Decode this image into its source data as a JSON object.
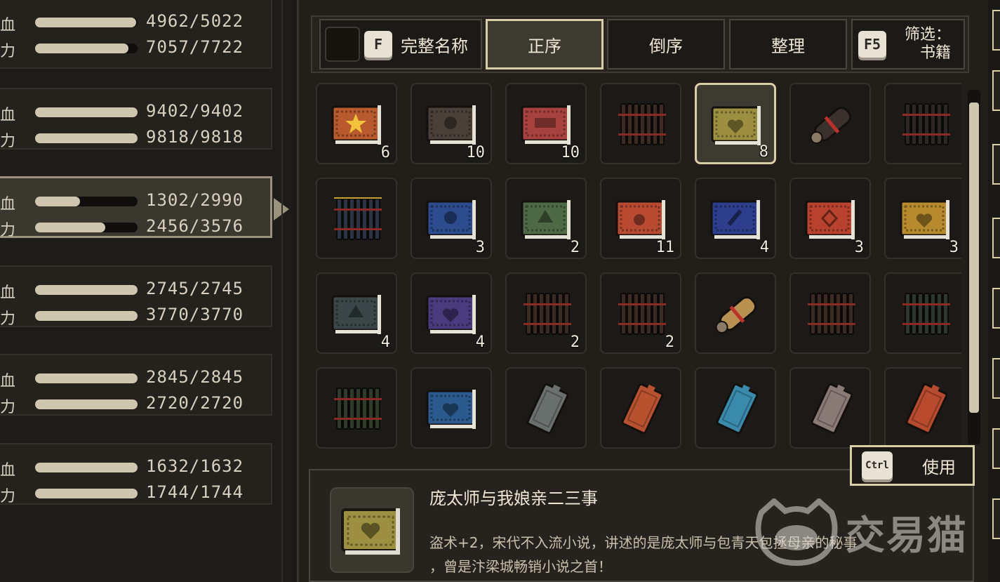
{
  "party": {
    "members": [
      {
        "hp_label": "气血",
        "mp_label": "内力",
        "hp": "4962/5022",
        "mp": "7057/7722",
        "hp_frac": 0.988,
        "mp_frac": 0.914,
        "active": false
      },
      {
        "hp_label": "气血",
        "mp_label": "内力",
        "hp": "9402/9402",
        "mp": "9818/9818",
        "hp_frac": 1.0,
        "mp_frac": 1.0,
        "active": false
      },
      {
        "hp_label": "气血",
        "mp_label": "内力",
        "hp": "1302/2990",
        "mp": "2456/3576",
        "hp_frac": 0.435,
        "mp_frac": 0.687,
        "active": true
      },
      {
        "hp_label": "气血",
        "mp_label": "内力",
        "hp": "2745/2745",
        "mp": "3770/3770",
        "hp_frac": 1.0,
        "mp_frac": 1.0,
        "active": false
      },
      {
        "hp_label": "气血",
        "mp_label": "内力",
        "hp": "2845/2845",
        "mp": "2720/2720",
        "hp_frac": 1.0,
        "mp_frac": 1.0,
        "active": false
      },
      {
        "hp_label": "气血",
        "mp_label": "内力",
        "hp": "1632/1632",
        "mp": "1744/1744",
        "hp_frac": 1.0,
        "mp_frac": 1.0,
        "active": false
      }
    ]
  },
  "toolbar": {
    "fullname_key": "F",
    "fullname_label": "完整名称",
    "sort_asc_label": "正序",
    "sort_desc_label": "倒序",
    "organize_label": "整理",
    "filter_key": "F5",
    "filter_label": "筛选：",
    "filter_value": "书籍"
  },
  "items": [
    {
      "icon": "scroll-star-book",
      "color": "#b85a2e",
      "count": "6"
    },
    {
      "icon": "skull-book",
      "color": "#4a4038",
      "count": "10"
    },
    {
      "icon": "pattern-book",
      "color": "#a8423e",
      "count": "10"
    },
    {
      "icon": "bamboo-scroll",
      "color": "#3a2a22",
      "count": ""
    },
    {
      "icon": "heart-book",
      "color": "#9c9040",
      "count": "8",
      "selected": true
    },
    {
      "icon": "rolled-scroll",
      "color": "#3a302c",
      "count": ""
    },
    {
      "icon": "bamboo-slips",
      "color": "#2e2622",
      "count": ""
    },
    {
      "icon": "bamboo-slips-blue",
      "color": "#2a3444",
      "count": ""
    },
    {
      "icon": "skull-book",
      "color": "#2c4c8e",
      "count": "3"
    },
    {
      "icon": "tree-book",
      "color": "#4e6a44",
      "count": "2"
    },
    {
      "icon": "fist-book",
      "color": "#b84a32",
      "count": "11"
    },
    {
      "icon": "sword-book",
      "color": "#2c3e8c",
      "count": "4"
    },
    {
      "icon": "diamond-book",
      "color": "#b8422e",
      "count": "3"
    },
    {
      "icon": "heart-book",
      "color": "#b88a2e",
      "count": "3"
    },
    {
      "icon": "spade-book",
      "color": "#3a4648",
      "count": "4"
    },
    {
      "icon": "heart-book",
      "color": "#4a3a7e",
      "count": "4"
    },
    {
      "icon": "bamboo-bundle",
      "color": "#3a2a24",
      "count": "2"
    },
    {
      "icon": "bamboo-scroll",
      "color": "#3a2a24",
      "count": "2"
    },
    {
      "icon": "rolled-scroll",
      "color": "#b89050",
      "count": ""
    },
    {
      "icon": "bamboo-slips",
      "color": "#3a2a24",
      "count": ""
    },
    {
      "icon": "bamboo-scroll",
      "color": "#2e3632",
      "count": ""
    },
    {
      "icon": "bamboo-slips-green",
      "color": "#2e3a2a",
      "count": ""
    },
    {
      "icon": "heart-book",
      "color": "#2a5a8e",
      "count": ""
    },
    {
      "icon": "thin-book",
      "color": "#6a706e",
      "count": ""
    },
    {
      "icon": "thin-book",
      "color": "#b8522e",
      "count": ""
    },
    {
      "icon": "thin-book",
      "color": "#3a8aac",
      "count": ""
    },
    {
      "icon": "thin-book",
      "color": "#8a7a76",
      "count": ""
    },
    {
      "icon": "thin-book",
      "color": "#b84a2e",
      "count": ""
    }
  ],
  "use_button": {
    "key": "Ctrl",
    "label": "使用"
  },
  "detail": {
    "title": "庞太师与我娘亲二三事",
    "line1": "盗术+2，宋代不入流小说，讲述的是庞太师与包青天包拯母亲的秘事",
    "line2": "，曾是汴梁城畅销小说之首！"
  },
  "watermark": {
    "text": "交易猫"
  }
}
